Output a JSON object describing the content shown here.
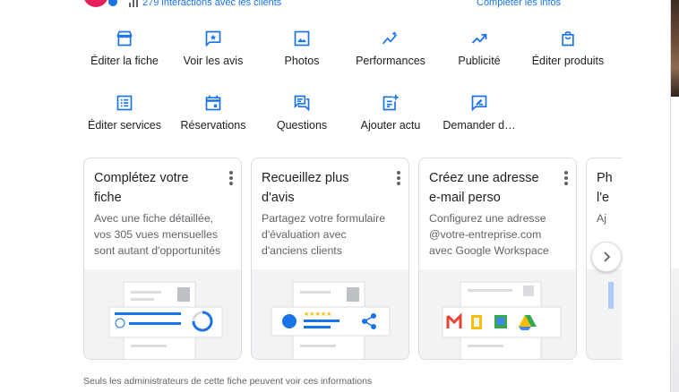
{
  "header": {
    "interactions_text": "279 interactions avec les clients",
    "complete_link": "Compléter les infos"
  },
  "actions": [
    {
      "label": "Éditer la fiche",
      "icon": "storefront-icon"
    },
    {
      "label": "Voir les avis",
      "icon": "star-review-icon"
    },
    {
      "label": "Photos",
      "icon": "photo-icon"
    },
    {
      "label": "Performances",
      "icon": "sparkle-trend-icon"
    },
    {
      "label": "Publicité",
      "icon": "trending-up-icon"
    },
    {
      "label": "Éditer produits",
      "icon": "shopping-bag-icon"
    },
    {
      "label": "Éditer services",
      "icon": "list-icon"
    },
    {
      "label": "Réservations",
      "icon": "calendar-icon"
    },
    {
      "label": "Questions",
      "icon": "question-answer-icon"
    },
    {
      "label": "Ajouter actu",
      "icon": "add-post-icon"
    },
    {
      "label": "Demander d…",
      "icon": "request-review-icon"
    }
  ],
  "cards": [
    {
      "title_1": "Complétez votre",
      "title_2": "fiche",
      "desc_1": "Avec une fiche détaillée,",
      "desc_2": "vos 305 vues mensuelles",
      "desc_3": "sont autant d'opportunités"
    },
    {
      "title_1": "Recueillez plus",
      "title_2": "d'avis",
      "desc_1": "Partagez votre formulaire",
      "desc_2": "d'évaluation avec",
      "desc_3": "d'anciens clients"
    },
    {
      "title_1": "Créez une adresse",
      "title_2": "e-mail perso",
      "desc_1": "Configurez une adresse",
      "desc_2": "@votre-entreprise.com",
      "desc_3": "avec Google Workspace"
    },
    {
      "title_1": "Ph",
      "title_2": "l'e",
      "desc_1": "Aj",
      "desc_2": "",
      "desc_3": ""
    }
  ],
  "footer_note": "Seuls les administrateurs de cette fiche peuvent voir ces informations",
  "colors": {
    "accent": "#1a73e8",
    "text": "#202124",
    "muted": "#5f6368",
    "border": "#dadce0"
  }
}
